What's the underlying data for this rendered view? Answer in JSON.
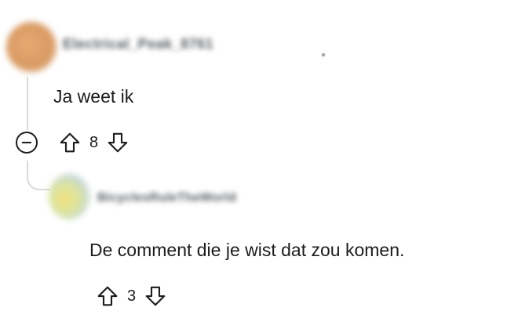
{
  "comments": [
    {
      "username": "Electrical_Peak_8761",
      "body": "Ja weet ik",
      "score": "8"
    },
    {
      "username": "BicyclesRuleTheWorld",
      "body": "De comment die je wist dat zou komen.",
      "score": "3"
    }
  ],
  "icons": {
    "upvote": "arrow-up-outline",
    "downvote": "arrow-down-outline",
    "collapse": "minus-circle"
  }
}
